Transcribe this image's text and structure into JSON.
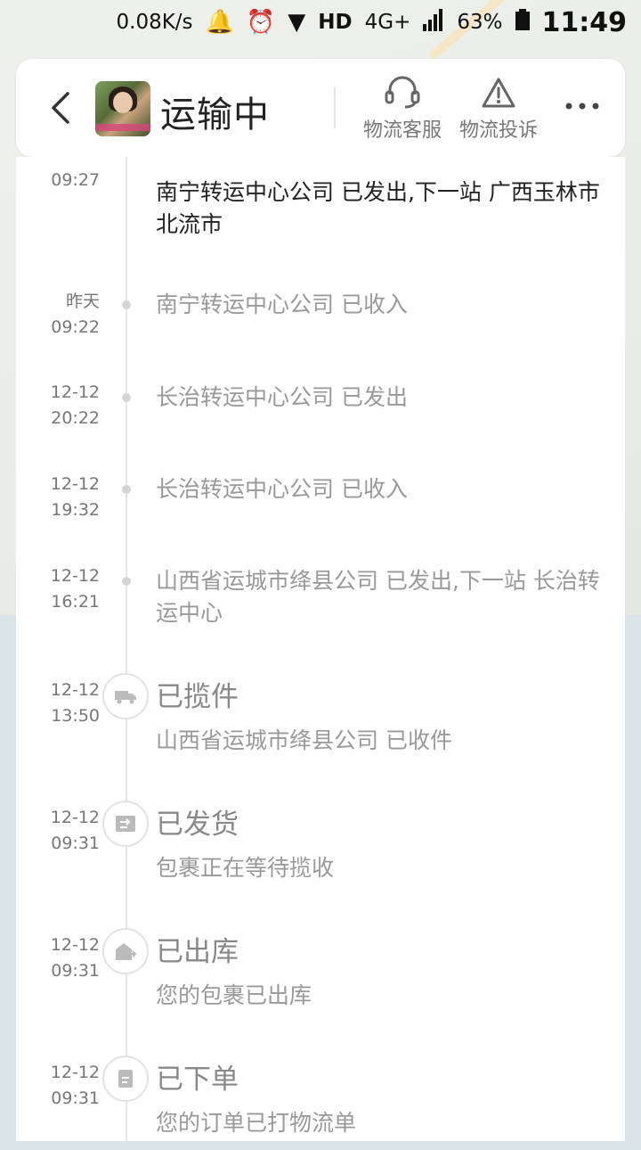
{
  "status_bar": {
    "net_speed": "0.08K/s",
    "network": "HD",
    "signal": "4G+",
    "battery": "63%",
    "time": "11:49"
  },
  "header": {
    "title": "运输中",
    "customer_service_label": "物流客服",
    "complaint_label": "物流投诉"
  },
  "timeline": [
    {
      "date": "",
      "time": "09:27",
      "text": "南宁转运中心公司 已发出,下一站 广西玉林市北流市",
      "active": true
    },
    {
      "date": "昨天",
      "time": "09:22",
      "text": "南宁转运中心公司 已收入"
    },
    {
      "date": "12-12",
      "time": "20:22",
      "text": "长治转运中心公司 已发出"
    },
    {
      "date": "12-12",
      "time": "19:32",
      "text": "长治转运中心公司 已收入"
    },
    {
      "date": "12-12",
      "time": "16:21",
      "text": "山西省运城市绛县公司 已发出,下一站 长治转运中心"
    },
    {
      "date": "12-12",
      "time": "13:50",
      "heading": "已揽件",
      "text": "山西省运城市绛县公司 已收件",
      "icon": "truck-icon"
    },
    {
      "date": "12-12",
      "time": "09:31",
      "heading": "已发货",
      "text": "包裹正在等待揽收",
      "icon": "shipped-icon"
    },
    {
      "date": "12-12",
      "time": "09:31",
      "heading": "已出库",
      "text": "您的包裹已出库",
      "icon": "warehouse-out-icon"
    },
    {
      "date": "12-12",
      "time": "09:31",
      "heading": "已下单",
      "text": "您的订单已打物流单",
      "icon": "order-icon"
    }
  ]
}
